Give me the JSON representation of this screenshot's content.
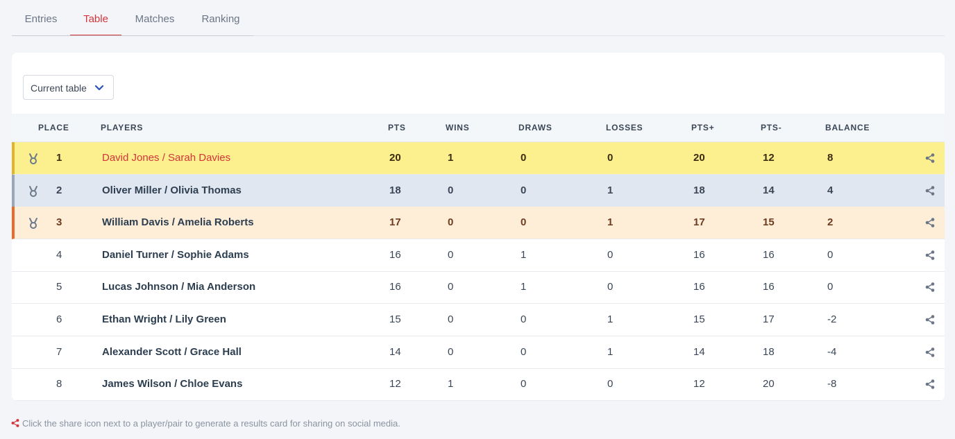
{
  "tabs": [
    {
      "label": "Entries",
      "active": false
    },
    {
      "label": "Table",
      "active": true
    },
    {
      "label": "Matches",
      "active": false
    },
    {
      "label": "Ranking",
      "active": false
    }
  ],
  "table_select": {
    "value": "Current table",
    "icon": "chevron-down-icon"
  },
  "columns": {
    "place": "PLACE",
    "players": "PLAYERS",
    "pts": "PTS",
    "wins": "WINS",
    "draws": "DRAWS",
    "losses": "LOSSES",
    "pts_plus": "PTS+",
    "pts_minus": "PTS-",
    "balance": "BALANCE"
  },
  "rows": [
    {
      "place": "1",
      "players": "David Jones / Sarah Davies",
      "pts": "20",
      "wins": "1",
      "draws": "0",
      "losses": "0",
      "pts_plus": "20",
      "pts_minus": "12",
      "balance": "8",
      "medal": "gold"
    },
    {
      "place": "2",
      "players": "Oliver Miller / Olivia Thomas",
      "pts": "18",
      "wins": "0",
      "draws": "0",
      "losses": "1",
      "pts_plus": "18",
      "pts_minus": "14",
      "balance": "4",
      "medal": "silver"
    },
    {
      "place": "3",
      "players": "William Davis / Amelia Roberts",
      "pts": "17",
      "wins": "0",
      "draws": "0",
      "losses": "1",
      "pts_plus": "17",
      "pts_minus": "15",
      "balance": "2",
      "medal": "bronze"
    },
    {
      "place": "4",
      "players": "Daniel Turner / Sophie Adams",
      "pts": "16",
      "wins": "0",
      "draws": "1",
      "losses": "0",
      "pts_plus": "16",
      "pts_minus": "16",
      "balance": "0",
      "medal": ""
    },
    {
      "place": "5",
      "players": "Lucas Johnson / Mia Anderson",
      "pts": "16",
      "wins": "0",
      "draws": "1",
      "losses": "0",
      "pts_plus": "16",
      "pts_minus": "16",
      "balance": "0",
      "medal": ""
    },
    {
      "place": "6",
      "players": "Ethan Wright / Lily Green",
      "pts": "15",
      "wins": "0",
      "draws": "0",
      "losses": "1",
      "pts_plus": "15",
      "pts_minus": "17",
      "balance": "-2",
      "medal": ""
    },
    {
      "place": "7",
      "players": "Alexander Scott / Grace Hall",
      "pts": "14",
      "wins": "0",
      "draws": "0",
      "losses": "1",
      "pts_plus": "14",
      "pts_minus": "18",
      "balance": "-4",
      "medal": ""
    },
    {
      "place": "8",
      "players": "James Wilson / Chloe Evans",
      "pts": "12",
      "wins": "1",
      "draws": "0",
      "losses": "0",
      "pts_plus": "12",
      "pts_minus": "20",
      "balance": "-8",
      "medal": ""
    }
  ],
  "footnote": "Click the share icon next to a player/pair to generate a results card for sharing on social media.",
  "colors": {
    "accent": "#d4343a",
    "gold_row": "#fcef8e",
    "silver_row": "#e1e7f0",
    "bronze_row": "#feeed8"
  }
}
